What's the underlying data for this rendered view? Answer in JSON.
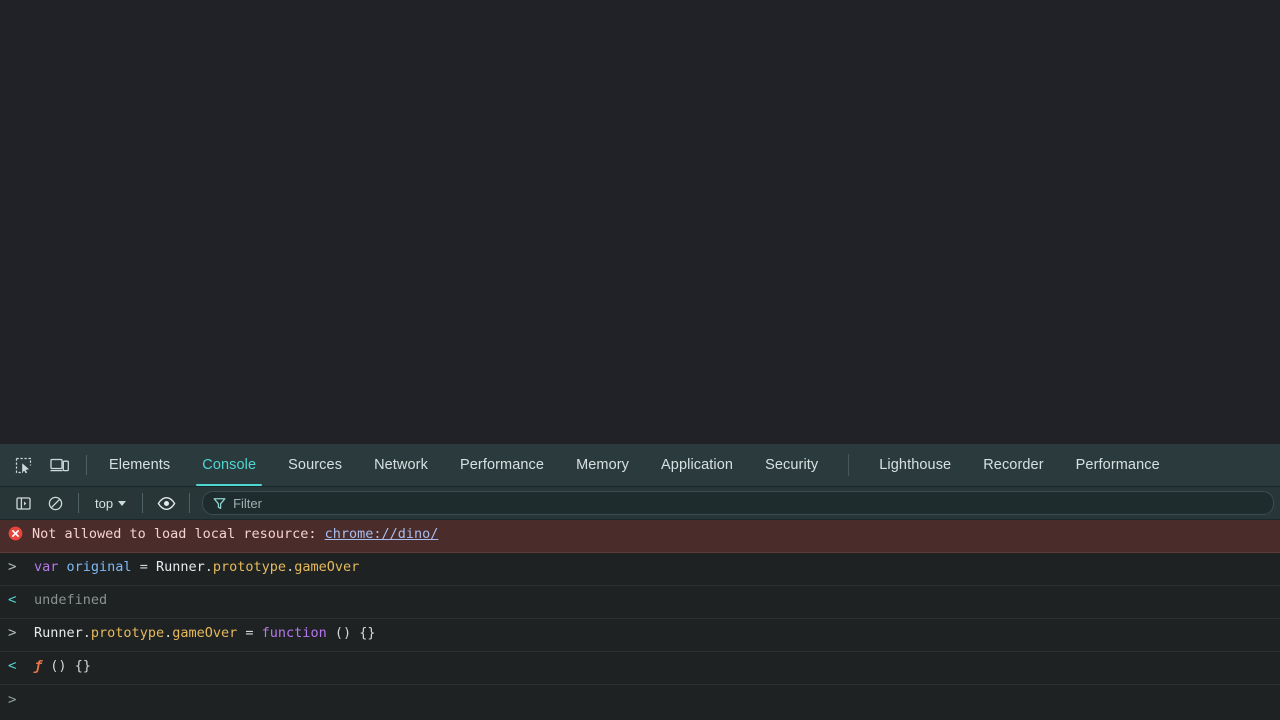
{
  "colors": {
    "accent": "#4fd6d2",
    "tabbar_bg": "#2b3b3d",
    "toolbar_bg": "#283638",
    "console_bg": "#1f2223",
    "viewport_bg": "#212227",
    "error_bg": "#4a2c2a",
    "error_icon": "#e8453c",
    "keyword": "#b478ec",
    "property": "#e5b95c",
    "variable": "#7eb8f5",
    "link": "#a8bdf0",
    "function_glyph": "#e8744a"
  },
  "tabbar": {
    "icons": [
      {
        "name": "inspect-element-icon",
        "title": "Inspect element"
      },
      {
        "name": "device-toolbar-icon",
        "title": "Toggle device toolbar"
      }
    ],
    "tabs_primary": [
      {
        "label": "Elements",
        "active": false
      },
      {
        "label": "Console",
        "active": true
      },
      {
        "label": "Sources",
        "active": false
      },
      {
        "label": "Network",
        "active": false
      },
      {
        "label": "Performance",
        "active": false
      },
      {
        "label": "Memory",
        "active": false
      },
      {
        "label": "Application",
        "active": false
      },
      {
        "label": "Security",
        "active": false
      }
    ],
    "tabs_secondary": [
      {
        "label": "Lighthouse",
        "active": false
      },
      {
        "label": "Recorder",
        "active": false
      },
      {
        "label": "Performance",
        "active": false
      }
    ]
  },
  "console_toolbar": {
    "sidebar_toggle": "console-sidebar-icon",
    "clear_console": "clear-console-icon",
    "context_value": "top",
    "live_expression": "eye-icon",
    "filter_icon": "filter-funnel-icon",
    "filter_value": "",
    "filter_placeholder": "Filter"
  },
  "console": {
    "rows": [
      {
        "type": "error",
        "icon": "error-circle-icon",
        "text": "Not allowed to load local resource: ",
        "link": "chrome://dino/"
      },
      {
        "type": "input",
        "gutter": ">",
        "tokens": [
          {
            "t": "var",
            "c": "kw"
          },
          {
            "t": " ",
            "c": "plain"
          },
          {
            "t": "original",
            "c": "var"
          },
          {
            "t": " ",
            "c": "plain"
          },
          {
            "t": "=",
            "c": "op"
          },
          {
            "t": " ",
            "c": "plain"
          },
          {
            "t": "Runner",
            "c": "id"
          },
          {
            "t": ".",
            "c": "punc"
          },
          {
            "t": "prototype",
            "c": "prop"
          },
          {
            "t": ".",
            "c": "punc"
          },
          {
            "t": "gameOver",
            "c": "prop"
          }
        ]
      },
      {
        "type": "output",
        "gutter": "<",
        "tokens": [
          {
            "t": "undefined",
            "c": "undef"
          }
        ]
      },
      {
        "type": "input",
        "gutter": ">",
        "tokens": [
          {
            "t": "Runner",
            "c": "id"
          },
          {
            "t": ".",
            "c": "punc"
          },
          {
            "t": "prototype",
            "c": "prop"
          },
          {
            "t": ".",
            "c": "punc"
          },
          {
            "t": "gameOver",
            "c": "prop"
          },
          {
            "t": " ",
            "c": "plain"
          },
          {
            "t": "=",
            "c": "op"
          },
          {
            "t": " ",
            "c": "plain"
          },
          {
            "t": "function",
            "c": "kw"
          },
          {
            "t": " ",
            "c": "plain"
          },
          {
            "t": "()",
            "c": "punc"
          },
          {
            "t": " ",
            "c": "plain"
          },
          {
            "t": "{}",
            "c": "punc"
          }
        ]
      },
      {
        "type": "output",
        "gutter": "<",
        "tokens": [
          {
            "t": "ƒ",
            "c": "fn"
          },
          {
            "t": " ",
            "c": "plain"
          },
          {
            "t": "()",
            "c": "punc"
          },
          {
            "t": " ",
            "c": "plain"
          },
          {
            "t": "{}",
            "c": "punc"
          }
        ]
      },
      {
        "type": "prompt",
        "gutter": ">",
        "tokens": []
      }
    ]
  }
}
